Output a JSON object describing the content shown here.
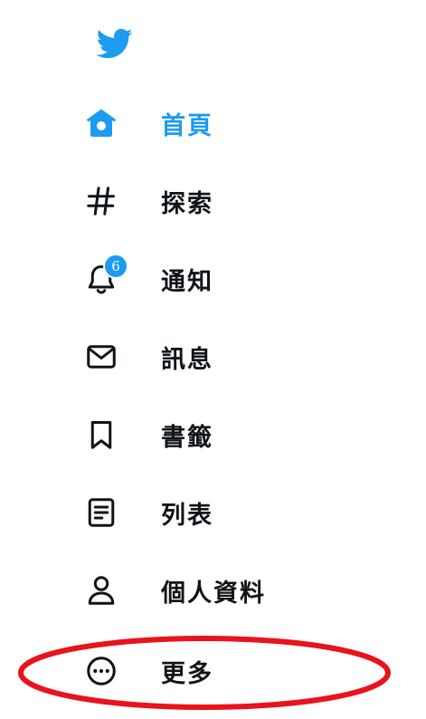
{
  "brand": {
    "logo_icon": "twitter-bird-icon",
    "accent_color": "#1d9bf0"
  },
  "nav": {
    "home": {
      "label": "首頁",
      "icon": "home-icon",
      "active": true
    },
    "explore": {
      "label": "探索",
      "icon": "hashtag-icon"
    },
    "notifications": {
      "label": "通知",
      "icon": "bell-icon",
      "badge": "6"
    },
    "messages": {
      "label": "訊息",
      "icon": "envelope-icon"
    },
    "bookmarks": {
      "label": "書籤",
      "icon": "bookmark-icon"
    },
    "lists": {
      "label": "列表",
      "icon": "list-icon"
    },
    "profile": {
      "label": "個人資料",
      "icon": "person-icon"
    },
    "more": {
      "label": "更多",
      "icon": "more-circle-icon"
    }
  },
  "annotation": {
    "highlight_color": "#e8131d",
    "highlight_target": "more"
  }
}
